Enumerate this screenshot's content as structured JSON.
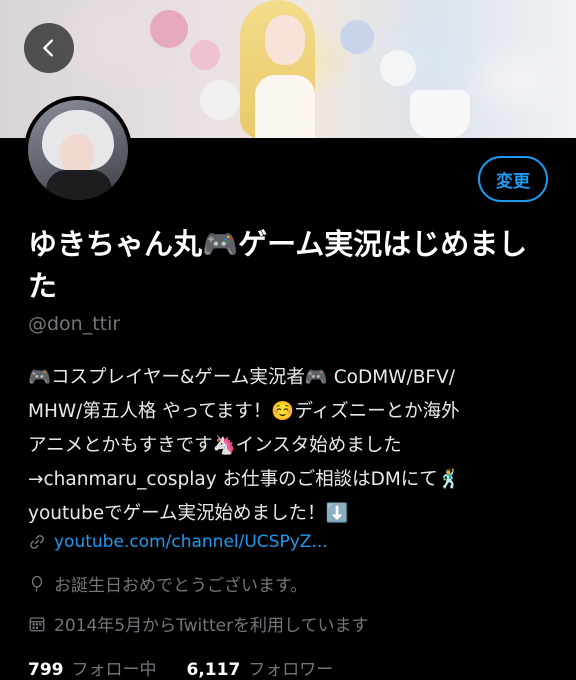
{
  "header": {
    "back_icon": "chevron-left-icon"
  },
  "profile": {
    "edit_label": "変更",
    "display_name": "ゆきちゃん丸🎮ゲーム実況はじめました",
    "username": "@don_ttir",
    "bio_lines": [
      "🎮コスプレイヤー&ゲーム実況者🎮 CoDMW/BFV/",
      "MHW/第五人格 やってます！☺️ディズニーとか海外",
      "アニメとかもすきです🦄インスタ始めました",
      "→chanmaru_cosplay お仕事のご相談はDMにて🕺",
      "youtubeでゲーム実況始めました！⬇️"
    ],
    "link_icon": "link-icon",
    "link": "youtube.com/channel/UCSPyZ...",
    "birthday_icon": "balloon-icon",
    "birthday": "お誕生日おめでとうございます。",
    "joined_icon": "calendar-icon",
    "joined": "2014年5月からTwitterを利用しています",
    "following_count": "799",
    "following_label": "フォロー中",
    "followers_count": "6,117",
    "followers_label": "フォロワー"
  },
  "colors": {
    "accent": "#1d9bf0",
    "background": "#000000",
    "secondary_text": "#71767b"
  }
}
